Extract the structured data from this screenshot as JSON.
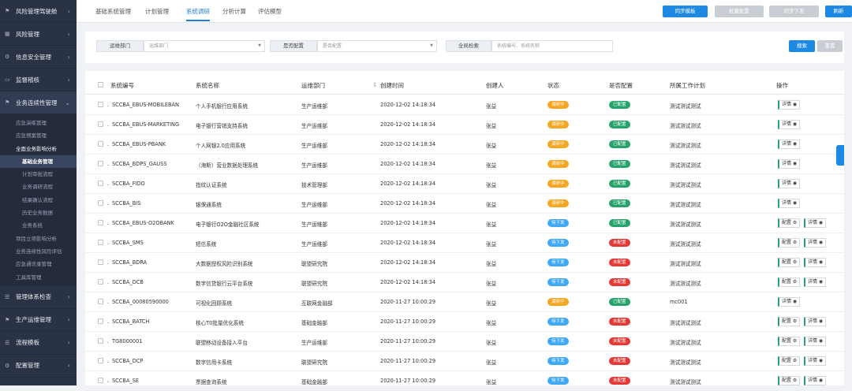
{
  "sidebar": {
    "menus": [
      {
        "label": "风险管理驾驶舱",
        "icon": "flag-icon",
        "arrow": "›"
      },
      {
        "label": "风险管理",
        "icon": "calendar-icon",
        "arrow": "›"
      },
      {
        "label": "信息安全管理",
        "icon": "gear-icon",
        "arrow": "›"
      },
      {
        "label": "监督稽核",
        "icon": "inbox-icon",
        "arrow": "›"
      },
      {
        "label": "业务连续性管理",
        "icon": "flag-icon",
        "arrow": "⌄"
      },
      {
        "label": "管理体系检查",
        "icon": "list-icon",
        "arrow": "›"
      },
      {
        "label": "生产运维管理",
        "icon": "flag-icon",
        "arrow": "›"
      },
      {
        "label": "流程模板",
        "icon": "list-icon",
        "arrow": "›"
      },
      {
        "label": "配置管理",
        "icon": "gear-icon",
        "arrow": "›"
      }
    ],
    "submenu": [
      {
        "label": "应急演练管理",
        "level": 1
      },
      {
        "label": "应急预案管理",
        "level": 1
      },
      {
        "label": "全面业务影响分析",
        "level": 1
      },
      {
        "label": "基础业务管理",
        "level": 2
      },
      {
        "label": "计划审批流程",
        "level": 2
      },
      {
        "label": "业务调研流程",
        "level": 2
      },
      {
        "label": "结果确认流程",
        "level": 2
      },
      {
        "label": "历史业务数据",
        "level": 2
      },
      {
        "label": "业务系统",
        "level": 2
      },
      {
        "label": "项目立项影响分析",
        "level": 1
      },
      {
        "label": "业务连续性风险评估",
        "level": 1
      },
      {
        "label": "应急通讯录管理",
        "level": 1
      },
      {
        "label": "工具库管理",
        "level": 1
      }
    ]
  },
  "tabs": [
    "基础系统管理",
    "计划管理",
    "系统调研",
    "分析计算",
    "评估模型"
  ],
  "toolbar": {
    "buttons": [
      "同步模板",
      "批量配置",
      "同步下发",
      "刷新"
    ]
  },
  "filter": {
    "dept_label": "运维部门",
    "dept_placeholder": "运维部门",
    "config_label": "是否配置",
    "config_placeholder": "是否配置",
    "search_label": "全局检索",
    "search_placeholder": "系统编号、系统名称",
    "search_btn": "搜索",
    "reset_btn": "重置"
  },
  "table": {
    "headers": [
      "系统编号",
      "系统名称",
      "运维部门",
      "创建时间",
      "创建人",
      "状态",
      "是否配置",
      "所属工作计划",
      "操作"
    ],
    "rows": [
      {
        "code": "SCCBA_EBUS-MOBILEBAN",
        "name": "个人手机银行应用系统",
        "dept": "生产运维部",
        "time": "2020-12-02 14:18:34",
        "creator": "张益",
        "status": "调研中",
        "configured": "已配置",
        "plan": "测试测试测试",
        "config_action": false
      },
      {
        "code": "SCCBA_EBUS-MARKETING",
        "name": "电子银行营销支持系统",
        "dept": "生产运维部",
        "time": "2020-12-02 14:18:34",
        "creator": "张益",
        "status": "调研中",
        "configured": "已配置",
        "plan": "测试测试测试",
        "config_action": false
      },
      {
        "code": "SCCBA_EBUS-PBANK",
        "name": "个人网银2.0应用系统",
        "dept": "生产运维部",
        "time": "2020-12-02 14:18:34",
        "creator": "张益",
        "status": "调研中",
        "configured": "已配置",
        "plan": "测试测试测试",
        "config_action": false
      },
      {
        "code": "SCCBA_BDPS_GAUSS",
        "name": "（海斯）营业数据处理系统",
        "dept": "生产运维部",
        "time": "2020-12-02 14:18:34",
        "creator": "张益",
        "status": "调研中",
        "configured": "已配置",
        "plan": "测试测试测试",
        "config_action": false
      },
      {
        "code": "SCCBA_FIDO",
        "name": "指纹认证系统",
        "dept": "技术管理部",
        "time": "2020-12-02 14:18:34",
        "creator": "张益",
        "status": "调研中",
        "configured": "已配置",
        "plan": "测试测试测试",
        "config_action": false
      },
      {
        "code": "SCCBA_BIS",
        "name": "银保通系统",
        "dept": "生产运维部",
        "time": "2020-12-02 14:18:34",
        "creator": "张益",
        "status": "调研中",
        "configured": "已配置",
        "plan": "测试测试测试",
        "config_action": false
      },
      {
        "code": "SCCBA_EBUS-O2OBANK",
        "name": "电子银行O2O金融社区系统",
        "dept": "生产运维部",
        "time": "2020-12-02 14:18:34",
        "creator": "张益",
        "status": "待下发",
        "configured": "已配置",
        "plan": "测试测试测试",
        "config_action": true
      },
      {
        "code": "SCCBA_SMS",
        "name": "短信系统",
        "dept": "生产运维部",
        "time": "2020-12-02 14:18:34",
        "creator": "张益",
        "status": "待下发",
        "configured": "未配置",
        "plan": "测试测试测试",
        "config_action": true
      },
      {
        "code": "SCCBA_BDRA",
        "name": "大数据授权风险识别系统",
        "dept": "联盟研究院",
        "time": "2020-12-02 14:18:34",
        "creator": "张益",
        "status": "待下发",
        "configured": "未配置",
        "plan": "测试测试测试",
        "config_action": true
      },
      {
        "code": "SCCBA_DCB",
        "name": "数字信贷银行云平台系统",
        "dept": "联盟研究院",
        "time": "2020-12-02 14:18:34",
        "creator": "张益",
        "status": "待下发",
        "configured": "未配置",
        "plan": "测试测试测试",
        "config_action": true
      },
      {
        "code": "SCCBA_00080590000",
        "name": "可视化回顾系统",
        "dept": "互联网金融部",
        "time": "2020-11-27 10:00:29",
        "creator": "张益",
        "status": "调研中",
        "configured": "已配置",
        "plan": "mc001",
        "config_action": false
      },
      {
        "code": "SCCBA_BATCH",
        "name": "核心T0批量优化系统",
        "dept": "基础金融部",
        "time": "2020-11-27 10:00:29",
        "creator": "张益",
        "status": "待下发",
        "configured": "未配置",
        "plan": "测试测试测试",
        "config_action": true
      },
      {
        "code": "TG8000001",
        "name": "联盟移动设备接入平台",
        "dept": "生产运维部",
        "time": "2020-11-27 10:00:29",
        "creator": "张益",
        "status": "待下发",
        "configured": "未配置",
        "plan": "测试测试测试",
        "config_action": true
      },
      {
        "code": "SCCBA_DCP",
        "name": "数字信用卡系统",
        "dept": "联盟研究院",
        "time": "2020-11-27 10:00:29",
        "creator": "张益",
        "status": "待下发",
        "configured": "未配置",
        "plan": "测试测试测试",
        "config_action": true
      },
      {
        "code": "SCCBA_SE",
        "name": "票据查询系统",
        "dept": "基础金融部",
        "time": "2020-11-27 10:00:29",
        "creator": "张益",
        "status": "待下发",
        "configured": "未配置",
        "plan": "测试测试测试",
        "config_action": true
      }
    ],
    "actions": {
      "config": "配置",
      "detail": "详情"
    }
  },
  "colors": {
    "sidebar_bg": "#2a3346",
    "accent": "#1e88e5",
    "status_investigating": "#f5a623",
    "status_pending": "#3fa9f5",
    "configured": "#25a36b",
    "unconfigured": "#e53935"
  }
}
